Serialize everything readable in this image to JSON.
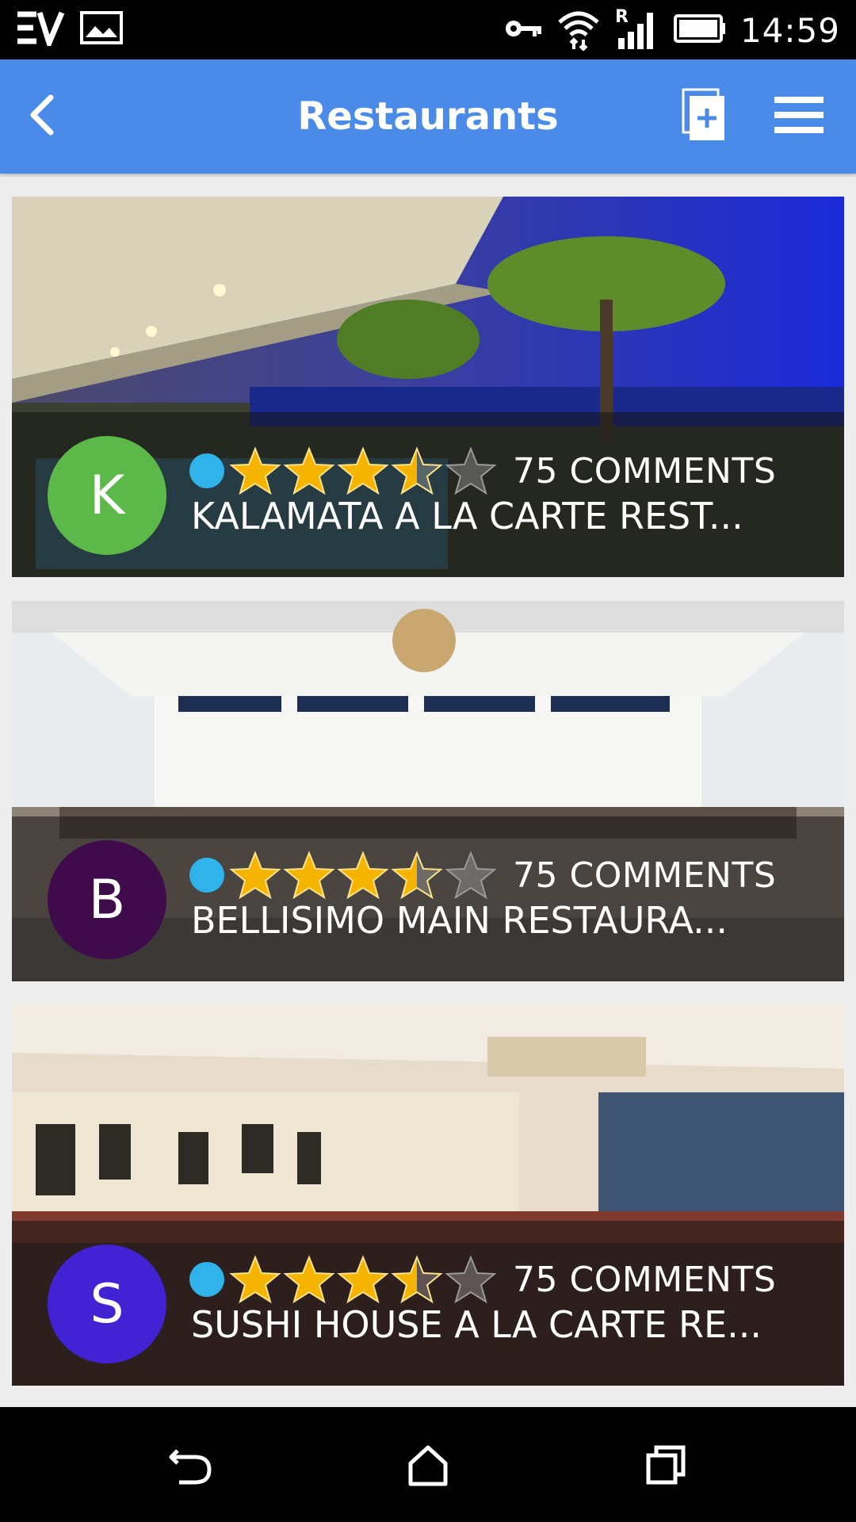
{
  "status_bar": {
    "time": "14:59",
    "app_logo_icon": "ev-logo-icon",
    "icons": [
      "image-icon",
      "key-icon",
      "wifi-icon",
      "signal-roaming-icon",
      "battery-icon"
    ]
  },
  "app_bar": {
    "title": "Restaurants",
    "background": "#4a8ae8",
    "back_icon": "chevron-left-icon",
    "add_icon": "add-document-icon",
    "menu_icon": "hamburger-menu-icon"
  },
  "rating_dot_color": "#2fb3ea",
  "restaurants": [
    {
      "initial": "K",
      "avatar_color": "#5cb848",
      "rating": 3.5,
      "max_rating": 5,
      "comments": "75 COMMENTS",
      "name": "KALAMATA A LA CARTE REST..."
    },
    {
      "initial": "B",
      "avatar_color": "#3f0b4a",
      "rating": 3.5,
      "max_rating": 5,
      "comments": "75 COMMENTS",
      "name": "BELLISIMO MAIN RESTAURA..."
    },
    {
      "initial": "S",
      "avatar_color": "#4123d4",
      "rating": 3.5,
      "max_rating": 5,
      "comments": "75 COMMENTS",
      "name": "SUSHI HOUSE A LA CARTE RE..."
    }
  ],
  "nav_bar": {
    "icons": [
      "back-icon",
      "home-icon",
      "recents-icon"
    ]
  }
}
